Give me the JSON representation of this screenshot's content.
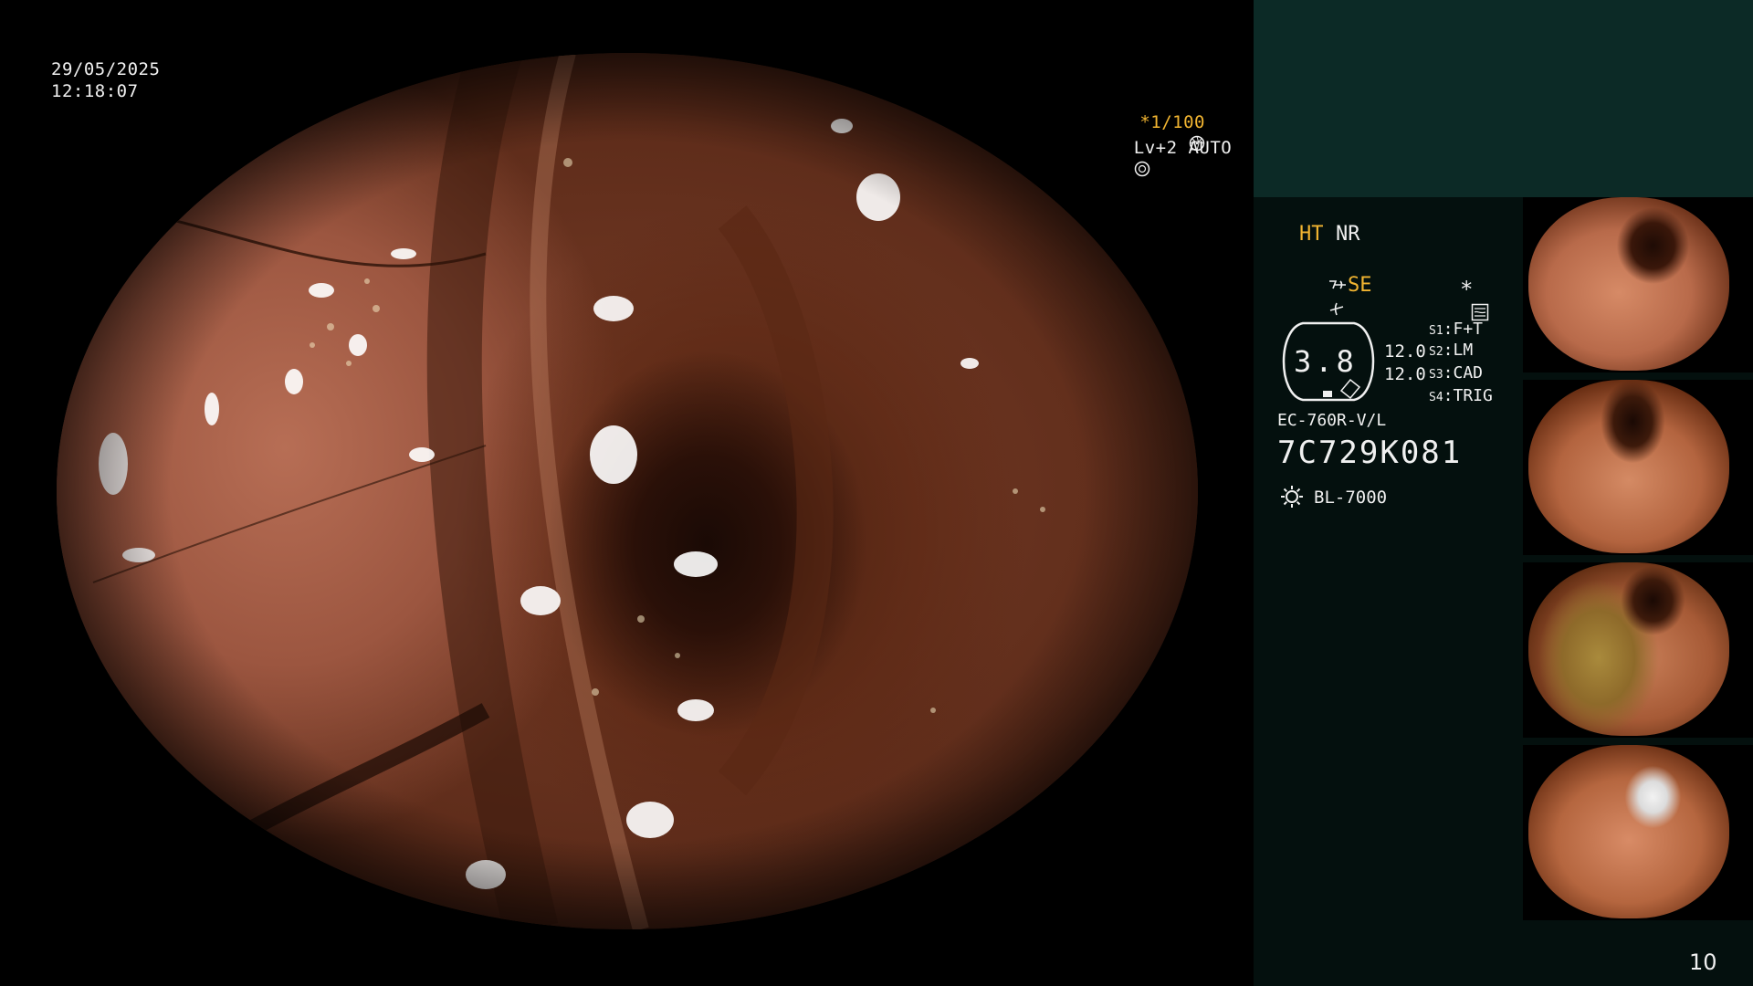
{
  "overlay": {
    "date": "29/05/2025",
    "time": "12:18:07",
    "shutter_prefix": "*",
    "shutter": "1/100",
    "level": "Lv+2 AUTO"
  },
  "panel": {
    "ht": "HT",
    "nr": "NR",
    "se": "SE",
    "star": "*",
    "gauge_value": "3.8",
    "value_1": "12.0",
    "value_2": "12.0",
    "s1": {
      "key": "S1",
      "value": "F+T"
    },
    "s2": {
      "key": "S2",
      "value": "LM"
    },
    "s3": {
      "key": "S3",
      "value": "CAD"
    },
    "s4": {
      "key": "S4",
      "value": "TRIG"
    },
    "scope_model": "EC-760R-V/L",
    "scope_serial": "7C729K081",
    "light_source": "BL-7000",
    "image_count": "10"
  },
  "icons": {
    "shutter_icon": "aperture-icon",
    "level_icon": "aperture-icon",
    "scope_icon": "scope-wave-icon",
    "mode_icon": "mode-panel-icon",
    "light_icon": "sun-icon"
  },
  "colors": {
    "accent_yellow": "#f2b531",
    "panel_top": "#0c2a26",
    "panel_bg": "#04100e"
  }
}
